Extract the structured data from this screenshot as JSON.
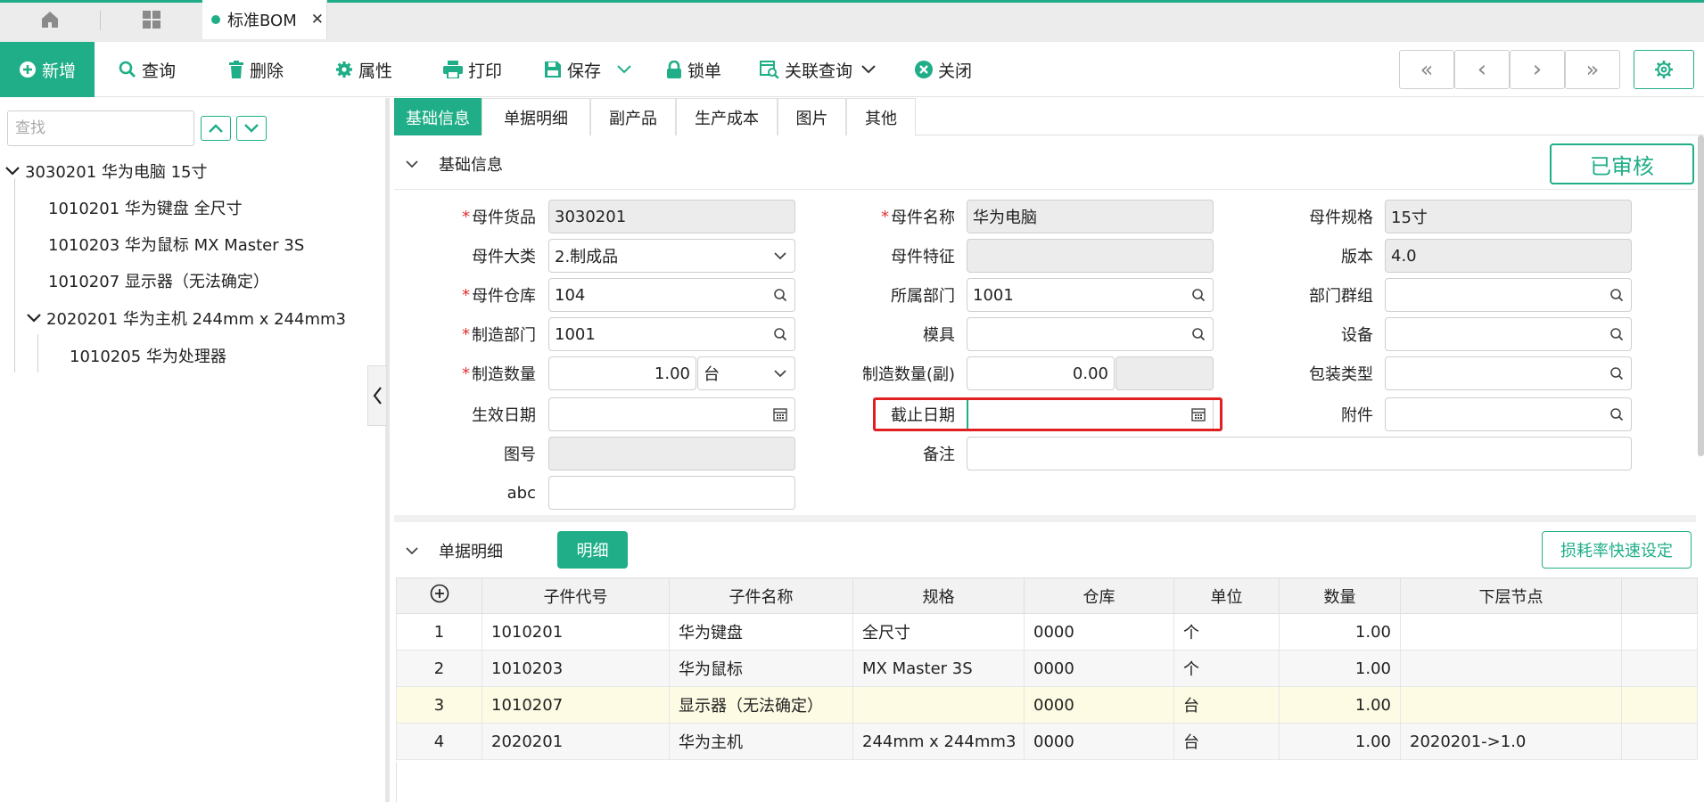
{
  "top_tabs": {
    "doc_tab": "标准BOM",
    "close_glyph": "✕"
  },
  "toolbar": {
    "new": "新增",
    "query": "查询",
    "delete": "删除",
    "properties": "属性",
    "print": "打印",
    "save": "保存",
    "lock": "锁单",
    "related_query": "关联查询",
    "close": "关闭",
    "nav": [
      "«",
      "‹",
      "›",
      "»"
    ]
  },
  "tree": {
    "search_placeholder": "查找",
    "nodes": [
      {
        "label": "3030201 华为电脑 15寸"
      },
      {
        "label": "1010201 华为键盘 全尺寸"
      },
      {
        "label": "1010203 华为鼠标 MX Master 3S"
      },
      {
        "label": "1010207 显示器（无法确定）"
      },
      {
        "label": "2020201 华为主机 244mm x 244mm3"
      },
      {
        "label": "1010205 华为处理器"
      }
    ]
  },
  "right_tabs": [
    "基础信息",
    "单据明细",
    "副产品",
    "生产成本",
    "图片",
    "其他"
  ],
  "basic": {
    "section_title": "基础信息",
    "status": "已审核",
    "labels": {
      "parent_code": "母件货品",
      "parent_name": "母件名称",
      "parent_spec": "母件规格",
      "parent_category": "母件大类",
      "parent_feature": "母件特征",
      "version": "版本",
      "parent_warehouse": "母件仓库",
      "dept": "所属部门",
      "dept_group": "部门群组",
      "mfg_dept": "制造部门",
      "mold": "模具",
      "equipment": "设备",
      "mfg_qty": "制造数量",
      "mfg_qty_sub": "制造数量(副)",
      "pack_type": "包装类型",
      "effective_date": "生效日期",
      "end_date": "截止日期",
      "attachment": "附件",
      "drawing_no": "图号",
      "remark": "备注",
      "abc": "abc"
    },
    "required_mark": "*",
    "values": {
      "parent_code": "3030201",
      "parent_name": "华为电脑",
      "parent_spec": "15寸",
      "parent_category": "2.制成品",
      "parent_feature": "",
      "version": "4.0",
      "parent_warehouse": "104",
      "dept": "1001",
      "dept_group": "",
      "mfg_dept": "1001",
      "mold": "",
      "equipment": "",
      "mfg_qty": "1.00",
      "mfg_unit": "台",
      "mfg_qty_sub": "0.00",
      "pack_type": "",
      "effective_date": "",
      "end_date": "",
      "attachment": "",
      "drawing_no": "",
      "remark": "",
      "abc": ""
    }
  },
  "detail": {
    "section_title": "单据明细",
    "detail_button": "明细",
    "loss_button": "损耗率快速设定",
    "columns": [
      "",
      "子件代号",
      "子件名称",
      "规格",
      "仓库",
      "单位",
      "数量",
      "下层节点",
      ""
    ],
    "rows": [
      {
        "no": "1",
        "code": "1010201",
        "name": "华为键盘",
        "spec": "全尺寸",
        "wh": "0000",
        "unit": "个",
        "qty": "1.00",
        "sub": ""
      },
      {
        "no": "2",
        "code": "1010203",
        "name": "华为鼠标",
        "spec": "MX Master 3S",
        "wh": "0000",
        "unit": "个",
        "qty": "1.00",
        "sub": ""
      },
      {
        "no": "3",
        "code": "1010207",
        "name": "显示器（无法确定）",
        "spec": "",
        "wh": "0000",
        "unit": "台",
        "qty": "1.00",
        "sub": ""
      },
      {
        "no": "4",
        "code": "2020201",
        "name": "华为主机",
        "spec": "244mm x 244mm3",
        "wh": "0000",
        "unit": "台",
        "qty": "1.00",
        "sub": "2020201->1.0"
      }
    ]
  },
  "colors": {
    "accent": "#1fae87",
    "required": "#e03030",
    "highlight_border": "#e02020",
    "selected_row": "#fdfbe3"
  }
}
